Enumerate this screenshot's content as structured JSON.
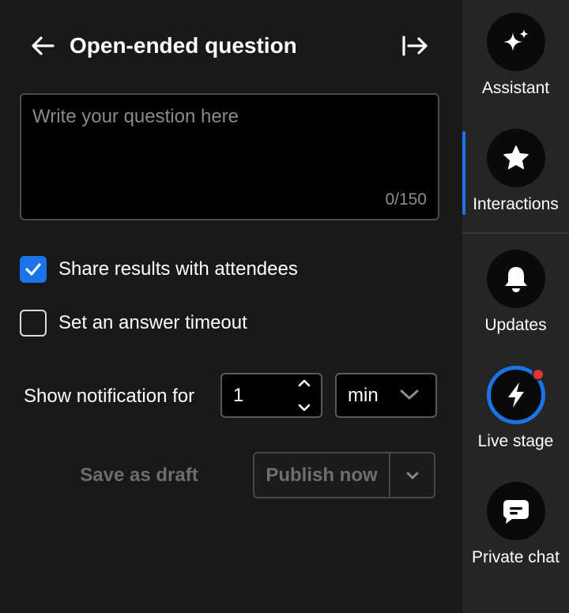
{
  "header": {
    "title": "Open-ended question",
    "back_icon": "arrow-left-icon",
    "collapse_icon": "collapse-panel-icon"
  },
  "question": {
    "placeholder": "Write your question here",
    "value": "",
    "char_count": "0/150"
  },
  "options": {
    "share_results": {
      "label": "Share results with attendees",
      "checked": true
    },
    "answer_timeout": {
      "label": "Set an answer timeout",
      "checked": false
    }
  },
  "notification": {
    "label": "Show notification for",
    "duration_value": "1",
    "unit_selected": "min"
  },
  "actions": {
    "draft_label": "Save as draft",
    "publish_label": "Publish now"
  },
  "sidebar": {
    "items": [
      {
        "label": "Assistant",
        "icon": "sparkles-icon"
      },
      {
        "label": "Interactions",
        "icon": "star-icon",
        "active": true
      },
      {
        "label": "Updates",
        "icon": "bell-icon"
      },
      {
        "label": "Live stage",
        "icon": "lightning-icon",
        "has_notification": true
      },
      {
        "label": "Private chat",
        "icon": "chat-bubble-icon"
      }
    ]
  },
  "colors": {
    "accent": "#1a73e8",
    "panel_bg": "#191919",
    "sidebar_bg": "#252525",
    "notification_dot": "#e5333a"
  }
}
